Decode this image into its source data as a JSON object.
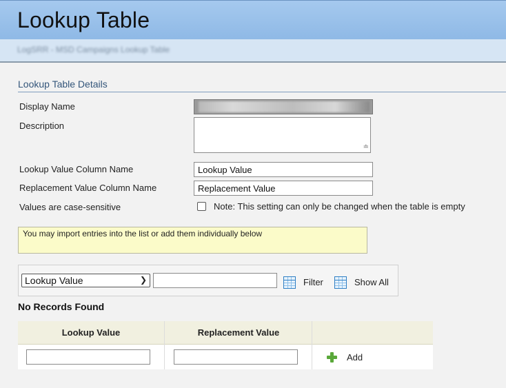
{
  "header": {
    "title": "Lookup Table",
    "subtitle_blurred": "LogSRR - MSD Campaigns Lookup Table"
  },
  "section": {
    "title": "Lookup Table Details"
  },
  "form": {
    "display_name_label": "Display Name",
    "description_label": "Description",
    "lookup_col_label": "Lookup Value Column Name",
    "lookup_col_value": "Lookup Value",
    "replacement_col_label": "Replacement Value Column Name",
    "replacement_col_value": "Replacement Value",
    "case_label": "Values are case-sensitive",
    "case_note": "Note: This setting can only be changed when the table is empty"
  },
  "info": {
    "message": "You may import entries into the list or add them individually below"
  },
  "filter": {
    "selected_column": "Lookup Value",
    "filter_label": "Filter",
    "show_all_label": "Show All"
  },
  "table": {
    "status": "No Records Found",
    "columns": [
      "Lookup Value",
      "Replacement Value"
    ],
    "add_label": "Add"
  },
  "colors": {
    "header_bg": "#9fc3ec",
    "info_bg": "#fbfbc9",
    "accent": "#33557a"
  }
}
